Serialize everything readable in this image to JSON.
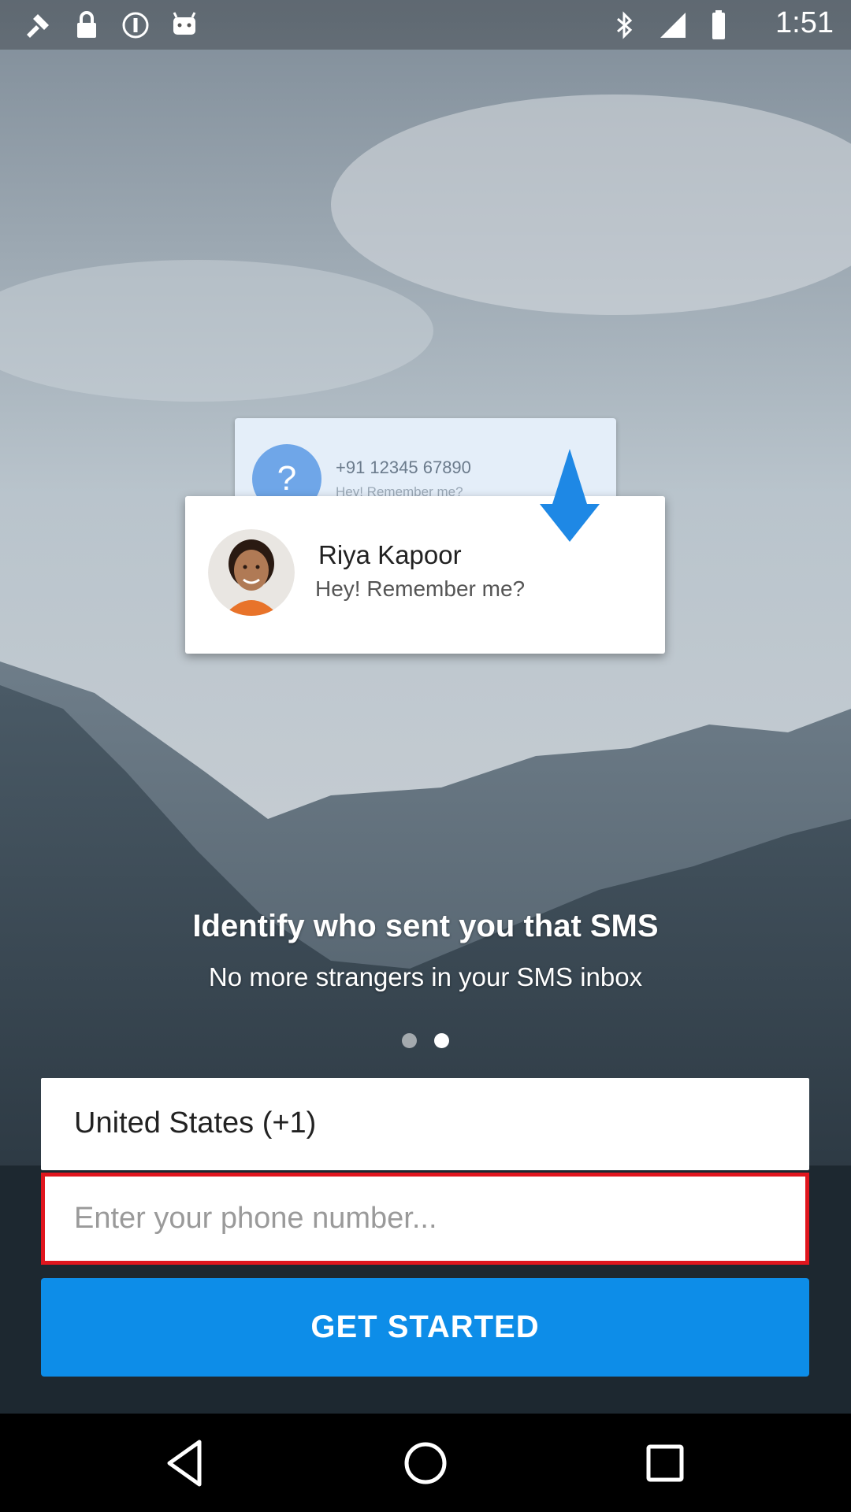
{
  "status_bar": {
    "time": "1:51",
    "icons": [
      "fake-gps-icon",
      "lock-icon",
      "info-icon",
      "android-icon",
      "bluetooth-icon",
      "signal-icon",
      "battery-icon"
    ]
  },
  "illustration": {
    "back_card": {
      "avatar_text": "?",
      "number": "+91 12345 67890",
      "preview": "Hey! Remember me?"
    },
    "front_card": {
      "name": "Riya Kapoor",
      "message": "Hey! Remember me?"
    },
    "arrow_color": "#1e88e5"
  },
  "onboarding": {
    "title": "Identify who sent you that SMS",
    "subtitle": "No more strangers in your SMS inbox",
    "page_count": 2,
    "active_page": 2
  },
  "form": {
    "country": "United States (+1)",
    "phone_placeholder": "Enter your phone number...",
    "phone_value": "",
    "submit_label": "GET STARTED"
  },
  "colors": {
    "accent": "#0d8de8",
    "error_border": "#e0161e"
  },
  "nav_bar": {
    "icons": [
      "back-icon",
      "home-icon",
      "recents-icon"
    ]
  }
}
